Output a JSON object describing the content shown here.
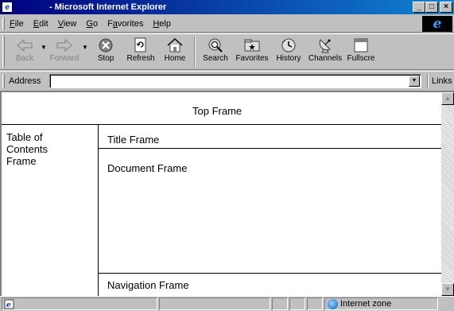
{
  "window": {
    "title": "- Microsoft Internet Explorer",
    "min_glyph": "_",
    "max_glyph": "□",
    "close_glyph": "×"
  },
  "menu": [
    {
      "pre": "",
      "u": "F",
      "post": "ile"
    },
    {
      "pre": "",
      "u": "E",
      "post": "dit"
    },
    {
      "pre": "",
      "u": "V",
      "post": "iew"
    },
    {
      "pre": "",
      "u": "G",
      "post": "o"
    },
    {
      "pre": "F",
      "u": "a",
      "post": "vorites"
    },
    {
      "pre": "",
      "u": "H",
      "post": "elp"
    }
  ],
  "toolbar": {
    "back": "Back",
    "forward": "Forward",
    "stop": "Stop",
    "refresh": "Refresh",
    "home": "Home",
    "search": "Search",
    "favorites": "Favorites",
    "history": "History",
    "channels": "Channels",
    "fullscreen": "Fullscre"
  },
  "address": {
    "label": "Address",
    "value": "",
    "links_label": "Links"
  },
  "frames": {
    "top": "Top Frame",
    "toc_line1": "Table of",
    "toc_line2": "Contents",
    "toc_line3": "Frame",
    "title": "Title Frame",
    "document": "Document Frame",
    "navigation": "Navigation Frame"
  },
  "status": {
    "zone": "Internet zone"
  },
  "colors": {
    "titlebar": "#000080",
    "chrome": "#c0c0c0"
  }
}
